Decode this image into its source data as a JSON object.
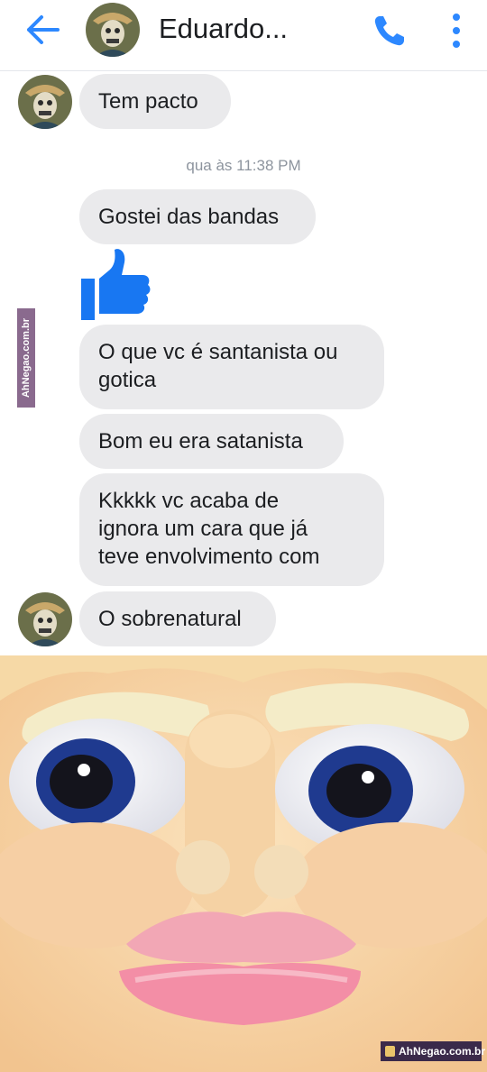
{
  "header": {
    "contact_name": "Eduardo...",
    "back_icon": "back-arrow-icon",
    "call_icon": "phone-icon",
    "menu_icon": "more-vertical-icon",
    "accent_color": "#2d88ff"
  },
  "messages": [
    {
      "text": "Tem pacto"
    },
    {
      "text": "Gostei das bandas"
    },
    {
      "text": "O que vc é santanista ou gotica"
    },
    {
      "text": "Bom eu era satanista"
    },
    {
      "text": "Kkkkk vc acaba de ignora um cara que já teve envolvimento com"
    },
    {
      "text": "O sobrenatural"
    }
  ],
  "message_lines": {
    "m3": [
      "O que vc é santanista ou",
      "gotica"
    ],
    "m5": [
      "Kkkkk vc acaba de",
      "ignora um cara que já",
      "teve envolvimento com"
    ]
  },
  "timestamp": "qua às 11:38 PM",
  "reaction": {
    "icon": "thumbs-up-icon",
    "color": "#1877f2"
  },
  "watermark": {
    "side": "AhNegao.com.br",
    "bottom": "AhNegao.com.br"
  }
}
